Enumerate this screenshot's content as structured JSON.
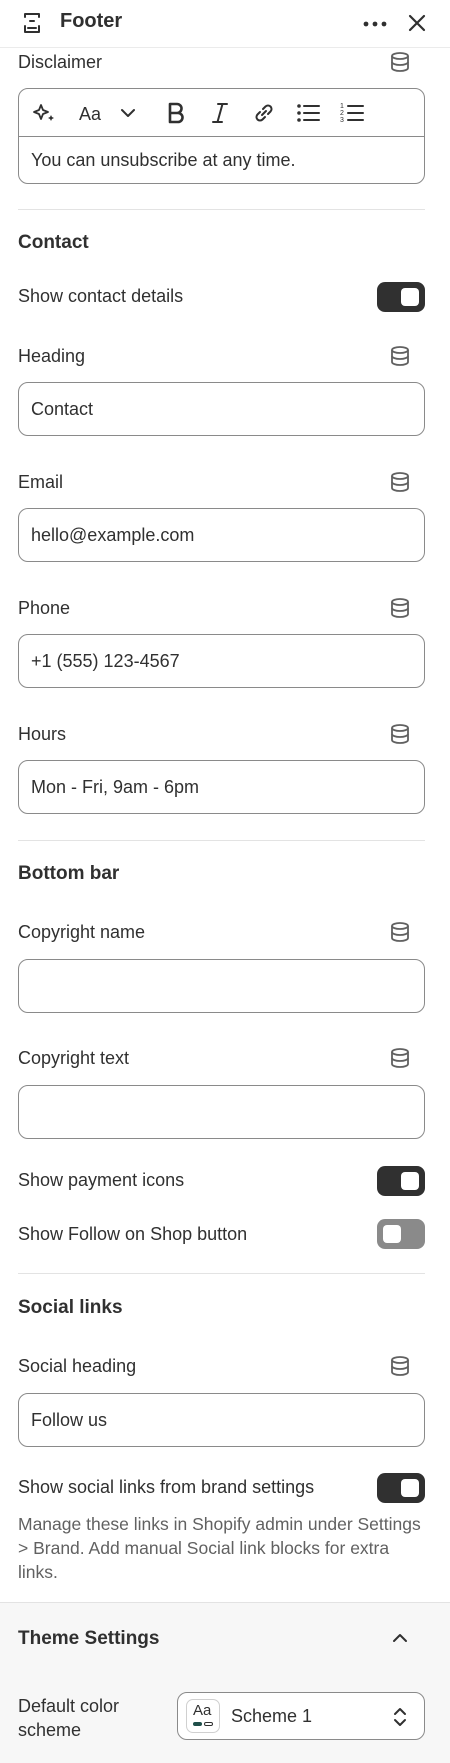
{
  "header": {
    "title": "Footer"
  },
  "disclaimer": {
    "label": "Disclaimer",
    "value": "You can unsubscribe at any time."
  },
  "contact": {
    "section_title": "Contact",
    "show_details_label": "Show contact details",
    "show_details_on": true,
    "heading_label": "Heading",
    "heading_value": "Contact",
    "email_label": "Email",
    "email_value": "hello@example.com",
    "phone_label": "Phone",
    "phone_value": "+1 (555) 123-4567",
    "hours_label": "Hours",
    "hours_value": "Mon - Fri, 9am - 6pm"
  },
  "bottom_bar": {
    "section_title": "Bottom bar",
    "copyright_name_label": "Copyright name",
    "copyright_name_value": "",
    "copyright_text_label": "Copyright text",
    "copyright_text_value": "",
    "payment_icons_label": "Show payment icons",
    "payment_icons_on": true,
    "follow_shop_label": "Show Follow on Shop button",
    "follow_shop_on": false
  },
  "social": {
    "section_title": "Social links",
    "heading_label": "Social heading",
    "heading_value": "Follow us",
    "brand_links_label": "Show social links from brand settings",
    "brand_links_on": true,
    "help_text": "Manage these links in Shopify admin under Settings > Brand. Add manual Social link blocks for extra links."
  },
  "theme_settings": {
    "title": "Theme Settings",
    "color_scheme_label": "Default color scheme",
    "color_scheme_value": "Scheme 1",
    "swatch_text": "Aa"
  },
  "icons": {
    "header_left": "layout-footer-icon",
    "more": "more-horizontal-icon",
    "close": "close-icon",
    "dynamic_source": "database-icon",
    "collapse": "chevron-up-icon",
    "select": "chevron-up-down-icon"
  },
  "colors": {
    "toggle_on": "#303030",
    "toggle_off": "#8a8a8a",
    "text": "#303030",
    "muted_text": "#616161",
    "border": "#8a8a8a",
    "swatch_accent": "#1f4f4a"
  }
}
